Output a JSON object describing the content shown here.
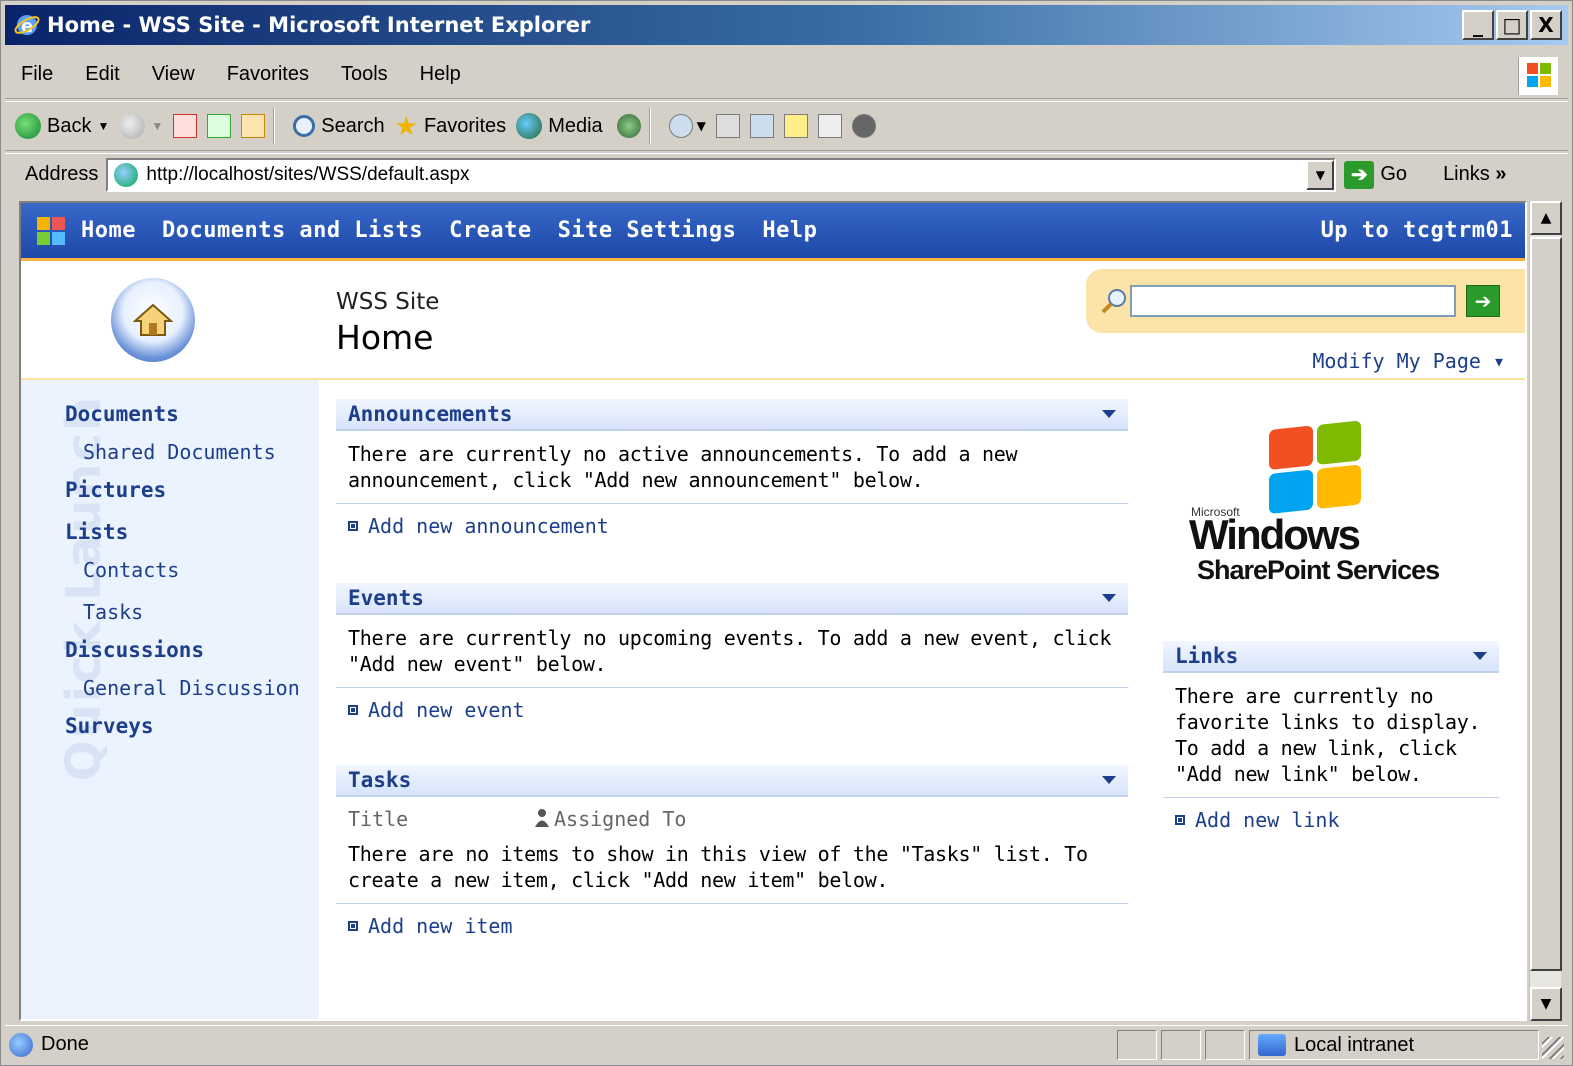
{
  "window": {
    "title": "Home - WSS Site - Microsoft Internet Explorer",
    "caption_buttons": [
      "_",
      "□",
      "X"
    ]
  },
  "menu": [
    "File",
    "Edit",
    "View",
    "Favorites",
    "Tools",
    "Help"
  ],
  "toolbar": {
    "back": "Back",
    "search": "Search",
    "favorites": "Favorites",
    "media": "Media"
  },
  "address": {
    "label": "Address",
    "url": "http://localhost/sites/WSS/default.aspx",
    "go": "Go",
    "links": "Links",
    "links_chevron": "»"
  },
  "sp_nav": {
    "items": [
      "Home",
      "Documents and Lists",
      "Create",
      "Site Settings",
      "Help"
    ],
    "up_to": "Up to tcgtrm01"
  },
  "header": {
    "site_name": "WSS Site",
    "page_title": "Home",
    "modify": "Modify My Page ▾",
    "search_placeholder": ""
  },
  "quick_launch": {
    "watermark": "Quick Launch",
    "documents": "Documents",
    "shared_documents": "Shared Documents",
    "pictures": "Pictures",
    "lists": "Lists",
    "contacts": "Contacts",
    "tasks": "Tasks",
    "discussions": "Discussions",
    "general_discussion": "General Discussion",
    "surveys": "Surveys"
  },
  "announcements": {
    "title": "Announcements",
    "body": "There are currently no active announcements. To add a new announcement, click \"Add new announcement\" below.",
    "add": "Add new announcement"
  },
  "events": {
    "title": "Events",
    "body": "There are currently no upcoming events. To add a new event, click \"Add new event\" below.",
    "add": "Add new event"
  },
  "tasks": {
    "title": "Tasks",
    "col_title": "Title",
    "col_assigned": "Assigned To",
    "body": "There are no items to show in this view of the \"Tasks\" list. To create a new item, click \"Add new item\" below.",
    "add": "Add new item"
  },
  "logo": {
    "microsoft": "Microsoft",
    "windows": "Windows",
    "sharepoint": "SharePoint Services"
  },
  "links_wp": {
    "title": "Links",
    "body": "There are currently no favorite links to display. To add a new link, click \"Add new link\" below.",
    "add": "Add new link"
  },
  "status": {
    "text": "Done",
    "zone": "Local intranet"
  }
}
